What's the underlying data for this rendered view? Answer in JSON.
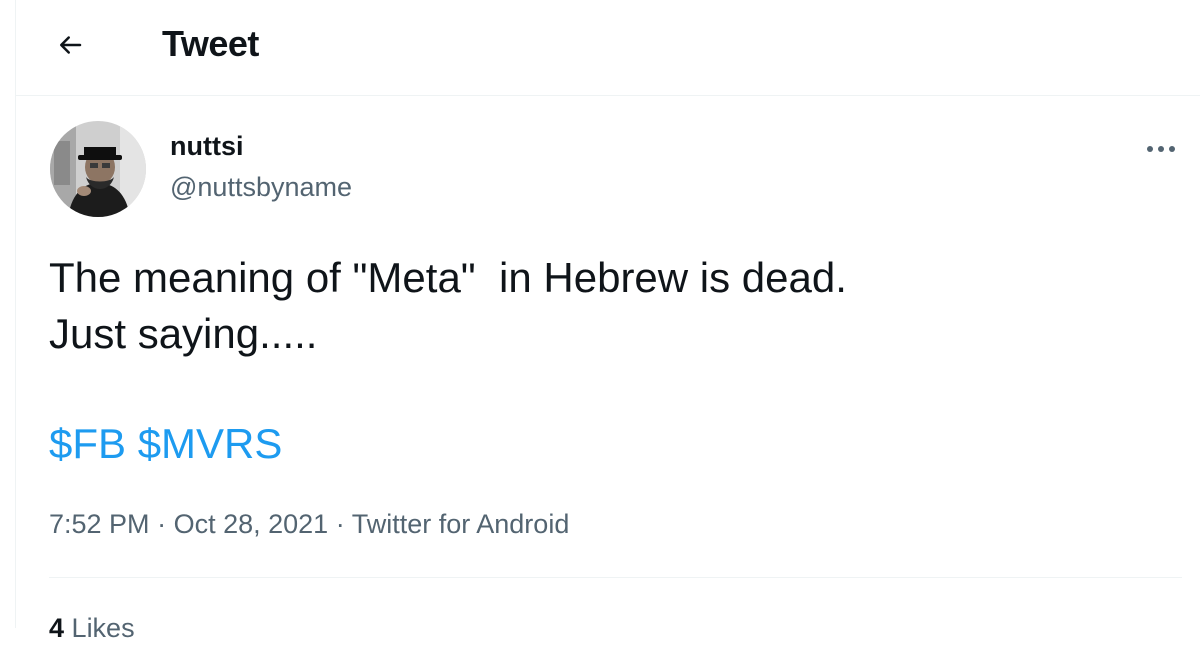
{
  "header": {
    "back_icon": "arrow-left-icon",
    "title": "Tweet"
  },
  "tweet": {
    "author": {
      "display_name": "nuttsi",
      "handle": "@nuttsbyname",
      "avatar_icon": "profile-photo"
    },
    "more_icon": "more-options-icon",
    "text_lines": [
      "The meaning of \"Meta\"  in Hebrew is dead.",
      "Just saying....."
    ],
    "cashtags": [
      "$FB",
      "$MVRS"
    ],
    "time": "7:52 PM",
    "date": "Oct 28, 2021",
    "source": "Twitter for Android",
    "separator": "·",
    "likes_count": "4",
    "likes_label": "Likes"
  },
  "colors": {
    "text": "#0f1419",
    "secondary": "#536471",
    "link": "#1d9bf0",
    "border": "#eff3f4"
  }
}
